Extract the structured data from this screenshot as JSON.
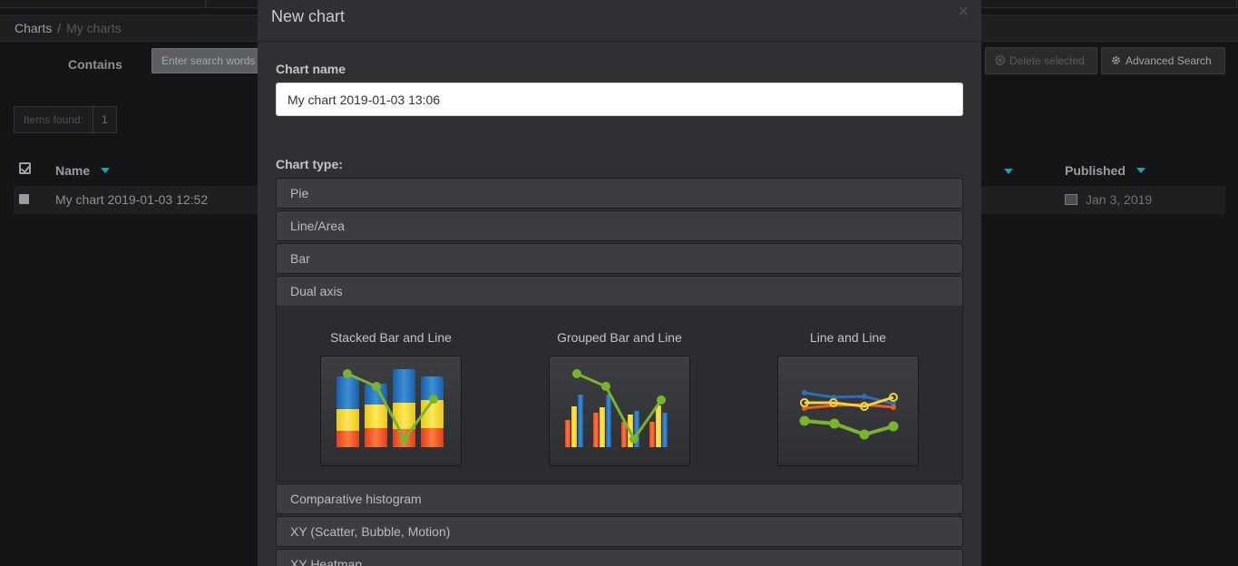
{
  "breadcrumb": {
    "root": "Charts",
    "separator": "/",
    "current": "My charts"
  },
  "search": {
    "label": "Contains",
    "placeholder": "Enter search words"
  },
  "toolbar": {
    "delete_label": "Delete selected",
    "advanced_label": "Advanced Search"
  },
  "items_found": {
    "label": "Items found:",
    "count": "1"
  },
  "table": {
    "columns": {
      "name": "Name",
      "published": "Published"
    },
    "rows": [
      {
        "name": "My chart 2019-01-03 12:52",
        "published": "Jan 3, 2019"
      }
    ]
  },
  "modal": {
    "title": "New chart",
    "close": "×",
    "chart_name_label": "Chart name",
    "chart_name_value": "My chart 2019-01-03 13:06",
    "chart_type_label": "Chart type:",
    "chart_types": [
      "Pie",
      "Line/Area",
      "Bar",
      "Dual axis",
      "Comparative histogram",
      "XY (Scatter, Bubble, Motion)",
      "XY Heatmap"
    ],
    "dual_axis_variants": [
      "Stacked Bar and Line",
      "Grouped Bar and Line",
      "Line and Line"
    ]
  },
  "colors": {
    "accent": "#19a3b8",
    "modal_bg": "#2e3033",
    "page_bg": "#141516"
  },
  "icons": {
    "check_all": "check-square-icon",
    "close": "close-icon",
    "delete": "circle-x-icon",
    "advanced": "gear-icon",
    "image": "image-icon",
    "sort": "caret-down-icon"
  }
}
